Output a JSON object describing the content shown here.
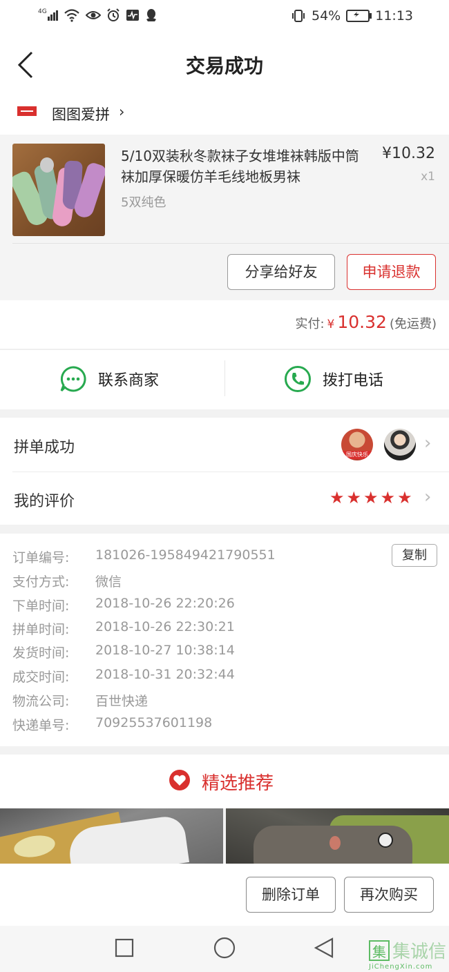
{
  "status_bar": {
    "signal": "4G",
    "battery": "54%",
    "time": "11:13"
  },
  "header": {
    "title": "交易成功"
  },
  "shop": {
    "name": "图图爱拼",
    "chevron": "›"
  },
  "product": {
    "title": "5/10双装秋冬款袜子女堆堆袜韩版中筒袜加厚保暖仿羊毛线地板男袜",
    "spec": "5双纯色",
    "price": "¥10.32",
    "quantity": "x1",
    "share_label": "分享给好友",
    "refund_label": "申请退款"
  },
  "payment": {
    "label": "实付:",
    "currency": "¥",
    "amount": "10.32",
    "shipping": "(免运费)"
  },
  "contact": {
    "merchant_label": "联系商家",
    "phone_label": "拨打电话"
  },
  "group": {
    "label": "拼单成功",
    "avatar1_badge": "国庆快乐"
  },
  "review": {
    "label": "我的评价",
    "stars": 5
  },
  "order_info": {
    "copy_label": "复制",
    "rows": [
      {
        "key": "订单编号:",
        "value": "181026-195849421790551"
      },
      {
        "key": "支付方式:",
        "value": "微信"
      },
      {
        "key": "下单时间:",
        "value": "2018-10-26 22:20:26"
      },
      {
        "key": "拼单时间:",
        "value": "2018-10-26 22:30:21"
      },
      {
        "key": "发货时间:",
        "value": "2018-10-27 10:38:14"
      },
      {
        "key": "成交时间:",
        "value": "2018-10-31 20:32:44"
      },
      {
        "key": "物流公司:",
        "value": "百世快递"
      },
      {
        "key": "快递单号:",
        "value": "70925537601198"
      }
    ]
  },
  "recommend": {
    "title": "精选推荐"
  },
  "bottom": {
    "delete_label": "删除订单",
    "rebuy_label": "再次购买"
  },
  "watermark": {
    "text": "集诚信",
    "url_text": "JiChengXin.com"
  },
  "colors": {
    "accent": "#d9302e",
    "green": "#27a94f"
  }
}
